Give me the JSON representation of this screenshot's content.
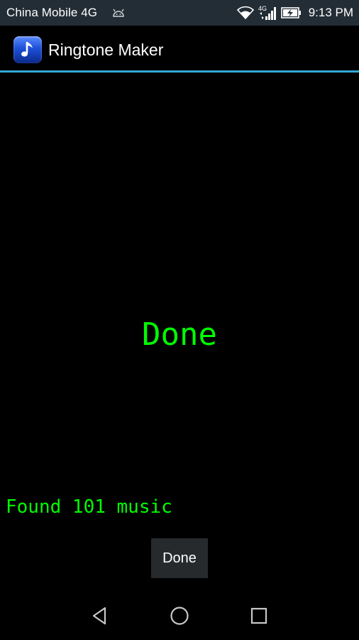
{
  "status_bar": {
    "carrier": "China Mobile 4G",
    "network_label": "4G",
    "time": "9:13 PM",
    "icons": [
      "android-debug-icon",
      "wifi-icon",
      "cellular-signal-icon",
      "battery-charging-icon"
    ]
  },
  "action_bar": {
    "title": "Ringtone Maker",
    "icon": "music-note-icon",
    "accent_color": "#33a8d8"
  },
  "main": {
    "heading": "Done",
    "status_message": "Found 101 music",
    "text_color": "#00ff00",
    "done_button_label": "Done"
  },
  "nav_bar": {
    "icons": [
      "back-icon",
      "home-icon",
      "recents-icon"
    ]
  }
}
